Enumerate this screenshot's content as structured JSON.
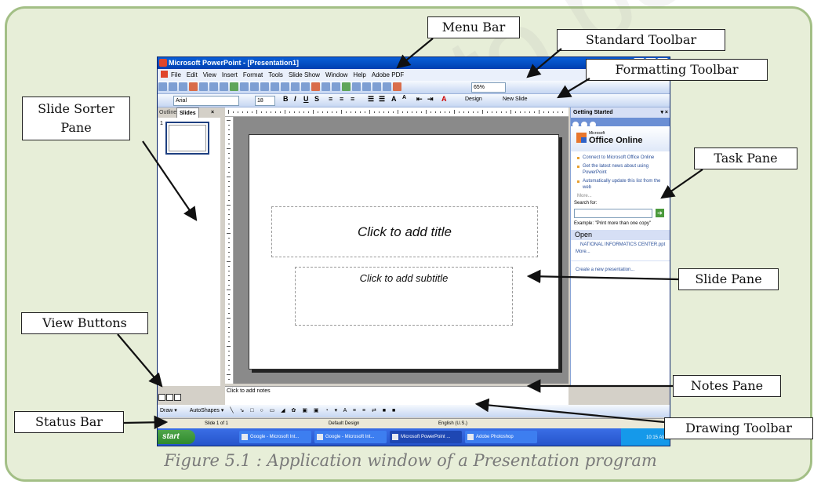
{
  "labels": {
    "menu_bar": "Menu Bar",
    "standard_toolbar": "Standard Toolbar",
    "formatting_toolbar": "Formatting Toolbar",
    "slide_sorter_pane_line1": "Slide Sorter",
    "slide_sorter_pane_line2": "Pane",
    "task_pane": "Task Pane",
    "slide_pane": "Slide Pane",
    "view_buttons": "View Buttons",
    "notes_pane": "Notes Pane",
    "status_bar": "Status Bar",
    "drawing_toolbar": "Drawing Toolbar"
  },
  "caption": "Figure 5.1 : Application window of a Presentation program",
  "watermark": "not to be",
  "app": {
    "title": "Microsoft PowerPoint - [Presentation1]",
    "menu": [
      "File",
      "Edit",
      "View",
      "Insert",
      "Format",
      "Tools",
      "Slide Show",
      "Window",
      "Help",
      "Adobe PDF"
    ],
    "zoom": "65%",
    "font_name": "Arial",
    "font_size": "18",
    "design_btn": "Design",
    "new_slide_btn": "New Slide",
    "tabs": {
      "outline": "Outline",
      "slides": "Slides",
      "close": "×"
    },
    "slide_number": "1",
    "title_placeholder": "Click to add title",
    "subtitle_placeholder": "Click to add subtitle",
    "notes_placeholder": "Click to add notes",
    "task_pane": {
      "header": "Getting Started",
      "close": "▾ ×",
      "logo_small": "Microsoft",
      "logo": "Office Online",
      "links": [
        "Connect to Microsoft Office Online",
        "Get the latest news about using PowerPoint",
        "Automatically update this list from the web"
      ],
      "more1": "More...",
      "search_label": "Search for:",
      "search_go": "➔",
      "example": "Example: \"Print more than one copy\"",
      "open_header": "Open",
      "recent_file": "NATIONAL INFORMATICS CENTER.ppt",
      "more2": "More...",
      "create": "Create a new presentation..."
    },
    "draw_bar": {
      "draw": "Draw ▾",
      "autoshapes": "AutoShapes ▾"
    },
    "status": {
      "slide": "Slide 1 of 1",
      "design": "Default Design",
      "language": "English (U.S.)"
    },
    "taskbar": {
      "start": "start",
      "tasks": [
        "Google - Microsoft Int...",
        "Google - Microsoft Int...",
        "Microsoft PowerPoint ...",
        "Adobe Photoshop"
      ],
      "clock": "10:15 AM"
    }
  }
}
